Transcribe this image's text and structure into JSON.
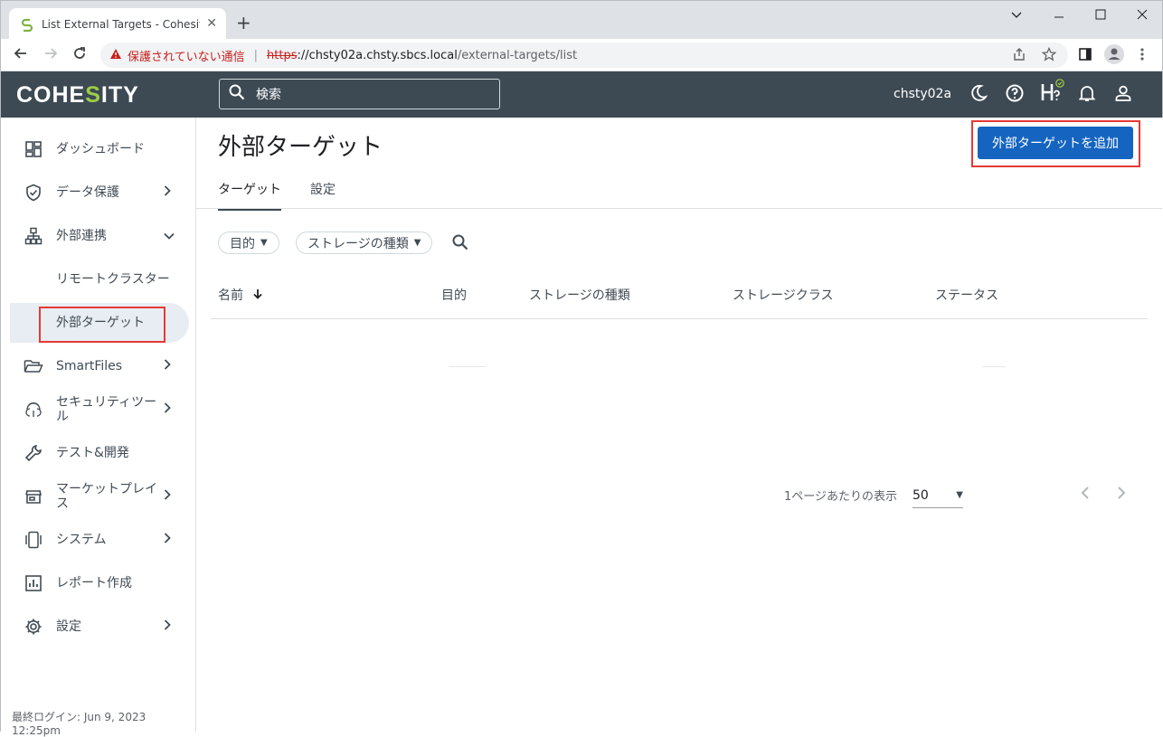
{
  "browser": {
    "tab_title": "List External Targets - Cohesity D",
    "close": "✕",
    "new_tab": "+",
    "warning_text": "保護されていない通信",
    "url_scheme": "https",
    "url_host": "://chsty02a.chsty.sbcs.local",
    "url_path": "/external-targets/list"
  },
  "app": {
    "logo_pre": "COHE",
    "logo_s": "S",
    "logo_post": "ITY",
    "search_placeholder": "検索",
    "user": "chsty02a"
  },
  "sidebar": {
    "items": [
      {
        "label": "ダッシュボード"
      },
      {
        "label": "データ保護"
      },
      {
        "label": "外部連携"
      },
      {
        "label": "リモートクラスター"
      },
      {
        "label": "外部ターゲット"
      },
      {
        "label": "SmartFiles"
      },
      {
        "label": "セキュリティツー\nル"
      },
      {
        "label": "テスト&開発"
      },
      {
        "label": "マーケットプレイ\nス"
      },
      {
        "label": "システム"
      },
      {
        "label": "レポート作成"
      },
      {
        "label": "設定"
      }
    ],
    "last_login": "最終ログイン: Jun 9, 2023 12:25pm"
  },
  "main": {
    "title": "外部ターゲット",
    "add_button": "外部ターゲットを追加",
    "tabs": [
      "ターゲット",
      "設定"
    ],
    "filters": [
      "目的",
      "ストレージの種類"
    ],
    "columns": [
      "名前",
      "目的",
      "ストレージの種類",
      "ストレージクラス",
      "ステータス"
    ],
    "pagination": {
      "label": "1ページあたりの表示",
      "value": "50"
    }
  },
  "colors": {
    "header_bg": "#3d4a54",
    "accent": "#1565c0",
    "highlight_box": "#e53935",
    "logo_s": "#9ccd43"
  }
}
